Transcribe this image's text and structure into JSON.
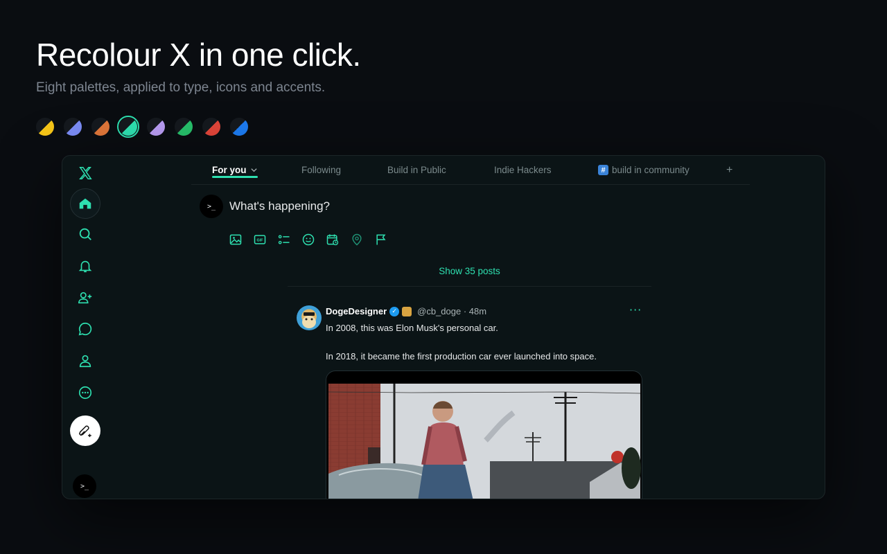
{
  "hero": {
    "title": "Recolour X in one click.",
    "subtitle": "Eight palettes, applied to type, icons and accents."
  },
  "palettes": [
    {
      "name": "yellow",
      "color": "#f5c518",
      "active": false
    },
    {
      "name": "periwinkle",
      "color": "#7b8cf5",
      "active": false
    },
    {
      "name": "orange",
      "color": "#e0773a",
      "active": false
    },
    {
      "name": "teal",
      "color": "#2ee0b0",
      "active": true
    },
    {
      "name": "lavender",
      "color": "#b89cf2",
      "active": false
    },
    {
      "name": "green",
      "color": "#27c06b",
      "active": false
    },
    {
      "name": "red",
      "color": "#e2463a",
      "active": false
    },
    {
      "name": "blue",
      "color": "#1d7cf2",
      "active": false
    }
  ],
  "accent_color": "#2ee0b0",
  "tabs": [
    {
      "label": "For you",
      "active": true
    },
    {
      "label": "Following",
      "active": false
    },
    {
      "label": "Build in Public",
      "active": false
    },
    {
      "label": "Indie Hackers",
      "active": false
    },
    {
      "label": "build in community",
      "active": false
    }
  ],
  "tab_hash_glyph": "#",
  "tab_add_glyph": "+",
  "composer": {
    "avatar_glyph": ">_",
    "placeholder": "What's happening?",
    "tools": [
      "image-icon",
      "gif-icon",
      "poll-icon",
      "emoji-icon",
      "schedule-icon",
      "location-icon",
      "flag-icon"
    ],
    "gif_label": "GIF"
  },
  "show_posts": "Show 35 posts",
  "tweet": {
    "name": "DogeDesigner",
    "handle_time": "@cb_doge · 48m",
    "line1": "In 2008, this was Elon Musk's personal car.",
    "line2": "In 2018, it became the first production car ever launched into space.",
    "more": "···"
  },
  "sidebar_avatar_glyph": ">_"
}
